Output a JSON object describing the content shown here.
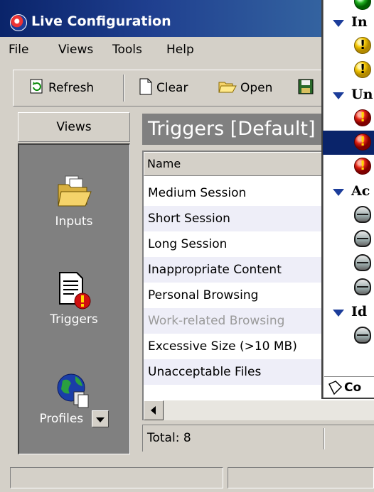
{
  "window": {
    "title": "Live Configuration"
  },
  "menu": [
    "File",
    "Views",
    "Tools",
    "Help"
  ],
  "toolbar": {
    "refresh": "Refresh",
    "clear": "Clear",
    "open": "Open"
  },
  "views": {
    "header": "Views",
    "items": [
      "Inputs",
      "Triggers",
      "Profiles"
    ]
  },
  "content": {
    "title": "Triggers [Default]",
    "column": "Name",
    "rows": [
      "Medium Session",
      "Short Session",
      "Long Session",
      "Inappropriate Content",
      "Personal Browsing",
      "Work-related Browsing",
      "Excessive Size (>10 MB)",
      "Unacceptable Files"
    ],
    "total": "Total: 8"
  },
  "popup": {
    "groups": [
      "In",
      "Un",
      "Ac",
      "Id"
    ],
    "footer": "Co"
  },
  "colors": {
    "title_bar": "#0a246a",
    "views_panel": "#808080",
    "selection": "#0a246a"
  }
}
